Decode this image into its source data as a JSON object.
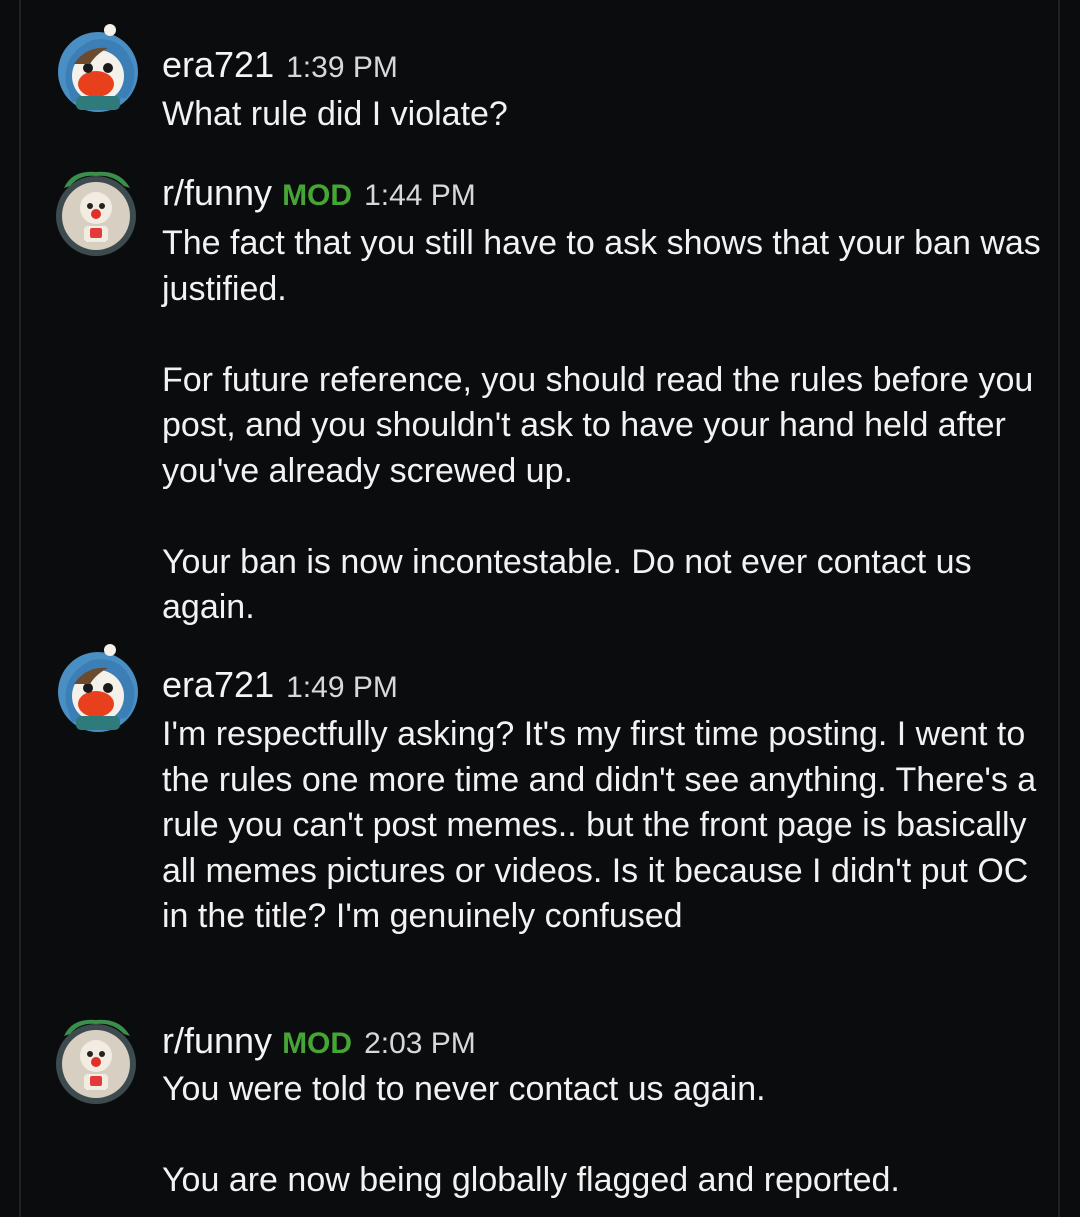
{
  "messages": [
    {
      "author": "era721",
      "mod_badge": "",
      "time": "1:39 PM",
      "avatar_icon": "snoo-hood-avatar-icon",
      "paragraphs": [
        "What rule did I violate?"
      ]
    },
    {
      "author": "r/funny",
      "mod_badge": "MOD",
      "time": "1:44 PM",
      "avatar_icon": "subreddit-clown-avatar-icon",
      "paragraphs": [
        "The fact that you still have to ask shows that your ban was justified.",
        "For future reference, you should read the rules before you post, and you shouldn't ask to have your hand held after you've already screwed up.",
        "Your ban is now incontestable. Do not ever contact us again."
      ]
    },
    {
      "author": "era721",
      "mod_badge": "",
      "time": "1:49 PM",
      "avatar_icon": "snoo-hood-avatar-icon",
      "paragraphs": [
        "I'm respectfully asking? It's my first time posting. I went to the rules one more time and didn't see anything. There's a rule you can't post memes.. but the front page is basically all memes pictures or videos. Is it because I didn't put OC in the title? I'm genuinely confused"
      ]
    },
    {
      "author": "r/funny",
      "mod_badge": "MOD",
      "time": "2:03 PM",
      "avatar_icon": "subreddit-clown-avatar-icon",
      "paragraphs": [
        "You were told to never contact us again.",
        "You are now being globally flagged and reported."
      ]
    }
  ],
  "colors": {
    "background": "#0b0c0e",
    "mod_badge": "#45a535",
    "text": "#f2f2f2"
  }
}
